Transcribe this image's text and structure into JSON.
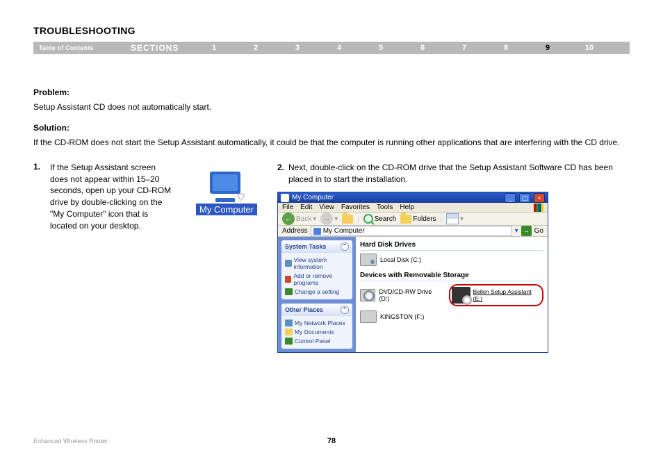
{
  "heading": "TROUBLESHOOTING",
  "nav": {
    "toc": "Table of Contents",
    "sections_label": "SECTIONS",
    "numbers": [
      "1",
      "2",
      "3",
      "4",
      "5",
      "6",
      "7",
      "8",
      "9",
      "10"
    ],
    "active_index": 8
  },
  "problem_label": "Problem:",
  "problem_text": "Setup Assistant CD does not automatically start.",
  "solution_label": "Solution:",
  "solution_text": "If the CD-ROM does not start the Setup Assistant automatically, it could be that the computer is running other applications that are interfering with the CD drive.",
  "step1": {
    "num": "1.",
    "text": "If the Setup Assistant screen does not appear within 15–20 seconds, open up your CD-ROM drive by double-clicking on the \"My Computer\" icon that is located on your desktop."
  },
  "mycomputer_label": "My Computer",
  "step2": {
    "num": "2.",
    "text": "Next, double-click on the CD-ROM drive that the Setup Assistant Software CD has been placed in to start the installation."
  },
  "window": {
    "title": "My Computer",
    "menus": [
      "File",
      "Edit",
      "View",
      "Favorites",
      "Tools",
      "Help"
    ],
    "toolbar": {
      "back": "Back",
      "search": "Search",
      "folders": "Folders"
    },
    "address_label": "Address",
    "address_value": "My Computer",
    "go": "Go",
    "panels": {
      "system_tasks": {
        "title": "System Tasks",
        "items": [
          "View system information",
          "Add or remove programs",
          "Change a setting"
        ]
      },
      "other_places": {
        "title": "Other Places",
        "items": [
          "My Network Places",
          "My Documents",
          "Control Panel"
        ]
      }
    },
    "groups": {
      "hdd": {
        "title": "Hard Disk Drives",
        "local_disk": "Local Disk (C:)"
      },
      "removable": {
        "title": "Devices with Removable Storage",
        "dvd": "DVD/CD-RW Drive (D:)",
        "belkin": "Belkin Setup Assistant (E:)",
        "kingston": "KINGSTON (F:)"
      }
    }
  },
  "footer": {
    "product": "Enhanced Wireless Router",
    "page": "78"
  }
}
